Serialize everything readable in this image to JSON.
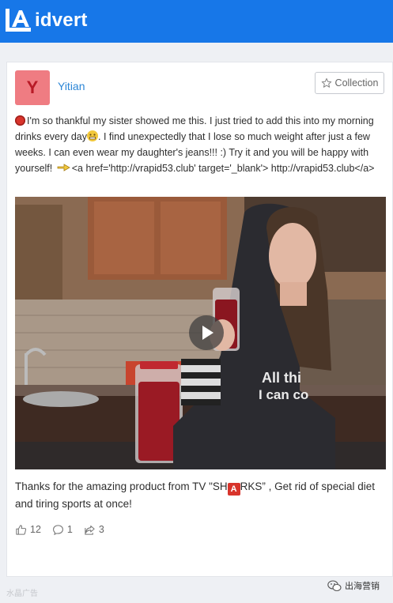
{
  "brand": {
    "logo_text": "idvert"
  },
  "post": {
    "avatar_letter": "Y",
    "username": "Yitian",
    "collection_label": "Collection",
    "text_1": "I'm so thankful my sister showed me this. I just tried to add this into my morning drinks every day",
    "text_2": ". I find unexpectedly that I lose so much weight after just a few weeks. I can even wear my daughter's jeans!!! :) Try it and you will be happy with yourself! ",
    "text_3": "<a href='http://vrapid53.club' target='_blank'> http://vrapid53.club</a>",
    "video_apron_text_1": "All thi",
    "video_apron_text_2": "I can co",
    "caption_1": "Thanks for the amazing product from TV \"SH",
    "caption_badge": "A",
    "caption_2": "RKS” , Get rid of special diet and tiring sports at once!",
    "likes": "12",
    "comments": "1",
    "shares": "3"
  },
  "footer": {
    "left_watermark": "水晶广告",
    "right_watermark": "出海营销"
  },
  "colors": {
    "topbar": "#1777e8",
    "username": "#2c86d6",
    "avatar_bg": "#ef7c82",
    "badge_red": "#d8342c"
  },
  "icons": [
    "logo-icon",
    "star-icon",
    "red-circle-icon",
    "emoji-icon",
    "pointing-hand-icon",
    "play-icon",
    "like-icon",
    "comment-icon",
    "share-icon",
    "wechat-icon"
  ]
}
